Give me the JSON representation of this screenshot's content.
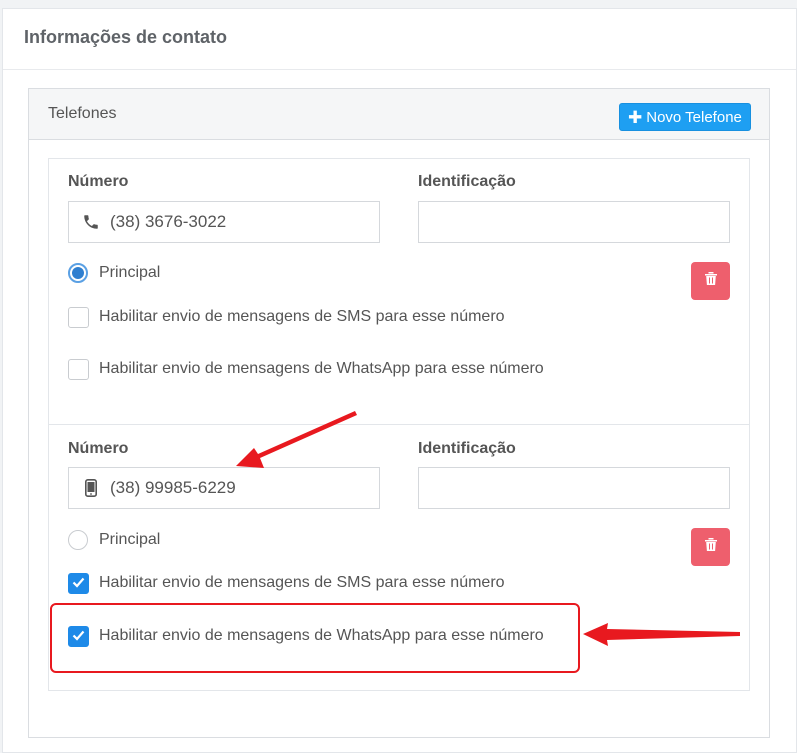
{
  "section": {
    "title": "Informações de contato"
  },
  "panel": {
    "title": "Telefones",
    "new_button_label": "Novo Telefone"
  },
  "phones": [
    {
      "number_label": "Número",
      "number_value": "(38) 3676-3022",
      "number_icon": "phone-icon",
      "id_label": "Identificação",
      "id_value": "",
      "principal_label": "Principal",
      "principal_checked": true,
      "sms_label": "Habilitar envio de mensagens de SMS para esse número",
      "sms_checked": false,
      "whatsapp_label": "Habilitar envio de mensagens de WhatsApp para esse número",
      "whatsapp_checked": false
    },
    {
      "number_label": "Número",
      "number_value": "(38) 99985-6229",
      "number_icon": "mobile-icon",
      "id_label": "Identificação",
      "id_value": "",
      "principal_label": "Principal",
      "principal_checked": false,
      "sms_label": "Habilitar envio de mensagens de SMS para esse número",
      "sms_checked": true,
      "whatsapp_label": "Habilitar envio de mensagens de WhatsApp para esse número",
      "whatsapp_checked": true
    }
  ],
  "colors": {
    "primary": "#1e9ff2",
    "danger": "#ee5f6d",
    "annotation": "#e8191f",
    "checkbox_checked": "#1e8ae8"
  }
}
